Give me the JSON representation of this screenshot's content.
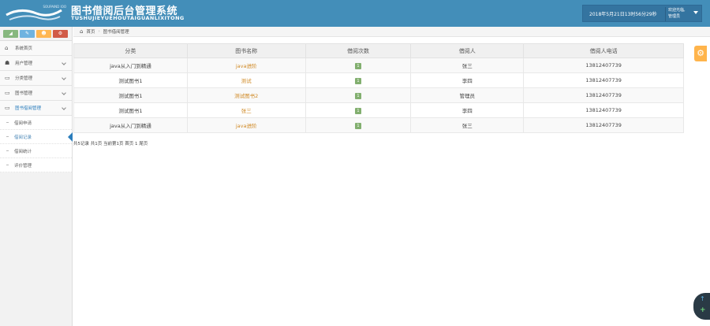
{
  "header": {
    "logo_text": "SOUPAIND IOO",
    "title": "图书借阅后台管理系统",
    "subtitle": "TUSHUJIEYUEHOUTAIGUANLIXITONG",
    "datetime": "2018年5月21日13时56分29秒",
    "welcome_label": "欢迎光临,",
    "username": "管理员"
  },
  "sidebar": {
    "items": [
      {
        "label": "系统首页",
        "icon": "home-icon"
      },
      {
        "label": "用户管理",
        "icon": "users-icon"
      },
      {
        "label": "分类管理",
        "icon": "desktop-icon"
      },
      {
        "label": "图书管理",
        "icon": "desktop-icon"
      },
      {
        "label": "图书借阅管理",
        "icon": "desktop-icon"
      }
    ],
    "subitems": [
      {
        "label": "借阅申请"
      },
      {
        "label": "借阅记录"
      },
      {
        "label": "借阅统计"
      },
      {
        "label": "评价管理"
      }
    ]
  },
  "breadcrumb": {
    "home": "首页",
    "current": "图书借阅管理"
  },
  "table": {
    "headers": [
      "分类",
      "图书名称",
      "借阅次数",
      "借阅人",
      "借阅人电话"
    ],
    "rows": [
      {
        "category": "java从入门到精通",
        "book": "java进阶",
        "count": "1",
        "borrower": "张三",
        "phone": "13812407739"
      },
      {
        "category": "测试图书1",
        "book": "测试",
        "count": "1",
        "borrower": "李四",
        "phone": "13812407739"
      },
      {
        "category": "测试图书1",
        "book": "测试图书2",
        "count": "1",
        "borrower": "管理员",
        "phone": "13812407739"
      },
      {
        "category": "测试图书1",
        "book": "张三",
        "count": "1",
        "borrower": "李四",
        "phone": "13812407739"
      },
      {
        "category": "java从入门到精通",
        "book": "java进阶",
        "count": "1",
        "borrower": "张三",
        "phone": "13812407739"
      }
    ]
  },
  "pager": {
    "text": "共5记录 共1页 当前第1页 首页 1 尾页"
  },
  "colors": {
    "header": "#438eb9",
    "accent": "#2b7dbc",
    "link": "#d08a26",
    "badge": "#82af6f"
  }
}
